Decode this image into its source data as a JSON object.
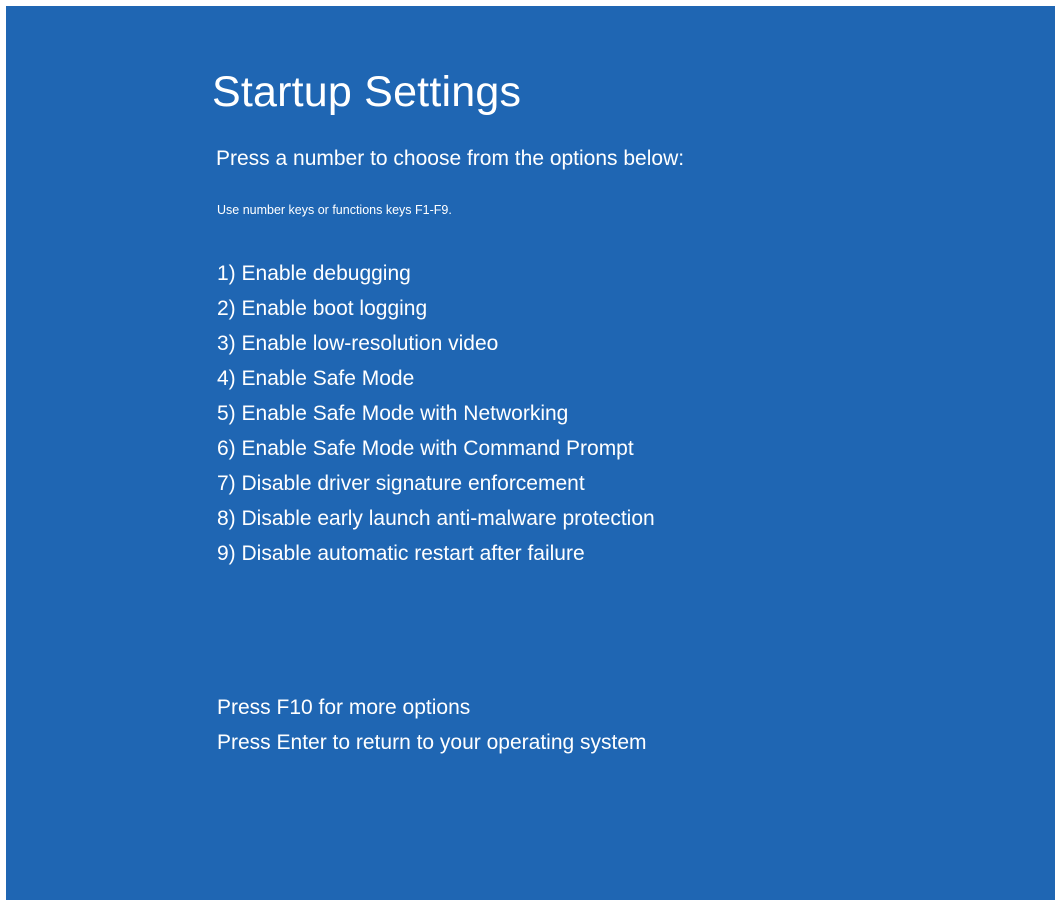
{
  "screen": {
    "background_color": "#1f66b3",
    "text_color": "#ffffff",
    "title": "Startup Settings",
    "subtitle": "Press a number to choose from the options below:",
    "hint": "Use number keys or functions keys F1-F9."
  },
  "options": [
    {
      "label": "1) Enable debugging"
    },
    {
      "label": "2) Enable boot logging"
    },
    {
      "label": "3) Enable low-resolution video"
    },
    {
      "label": "4) Enable Safe Mode"
    },
    {
      "label": "5) Enable Safe Mode with Networking"
    },
    {
      "label": "6) Enable Safe Mode with Command Prompt"
    },
    {
      "label": "7) Disable driver signature enforcement"
    },
    {
      "label": "8) Disable early launch anti-malware protection"
    },
    {
      "label": "9) Disable automatic restart after failure"
    }
  ],
  "footer": {
    "more_options": "Press F10 for more options",
    "return": "Press Enter to return to your operating system"
  }
}
